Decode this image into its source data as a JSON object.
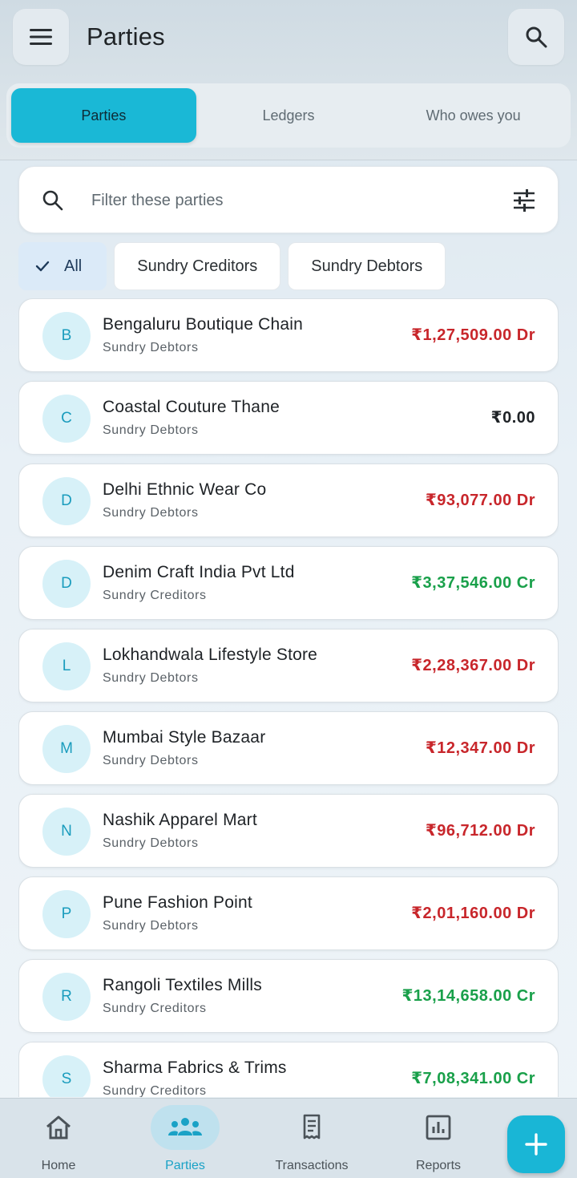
{
  "header": {
    "title": "Parties",
    "menu_icon": "menu-icon",
    "search_icon": "search-icon"
  },
  "tabs": [
    {
      "label": "Parties",
      "active": true
    },
    {
      "label": "Ledgers",
      "active": false
    },
    {
      "label": "Who owes you",
      "active": false
    }
  ],
  "filter": {
    "placeholder": "Filter these parties",
    "value": ""
  },
  "chips": [
    {
      "label": "All",
      "selected": true
    },
    {
      "label": "Sundry Creditors",
      "selected": false
    },
    {
      "label": "Sundry Debtors",
      "selected": false
    }
  ],
  "parties": [
    {
      "initial": "B",
      "name": "Bengaluru Boutique Chain",
      "group": "Sundry Debtors",
      "amount": "₹1,27,509.00 Dr",
      "type": "dr"
    },
    {
      "initial": "C",
      "name": "Coastal Couture Thane",
      "group": "Sundry Debtors",
      "amount": "₹0.00",
      "type": "zero"
    },
    {
      "initial": "D",
      "name": "Delhi Ethnic Wear Co",
      "group": "Sundry Debtors",
      "amount": "₹93,077.00 Dr",
      "type": "dr"
    },
    {
      "initial": "D",
      "name": "Denim Craft India Pvt Ltd",
      "group": "Sundry Creditors",
      "amount": "₹3,37,546.00 Cr",
      "type": "cr"
    },
    {
      "initial": "L",
      "name": "Lokhandwala Lifestyle Store",
      "group": "Sundry Debtors",
      "amount": "₹2,28,367.00 Dr",
      "type": "dr"
    },
    {
      "initial": "M",
      "name": "Mumbai Style Bazaar",
      "group": "Sundry Debtors",
      "amount": "₹12,347.00 Dr",
      "type": "dr"
    },
    {
      "initial": "N",
      "name": "Nashik Apparel Mart",
      "group": "Sundry Debtors",
      "amount": "₹96,712.00 Dr",
      "type": "dr"
    },
    {
      "initial": "P",
      "name": "Pune Fashion Point",
      "group": "Sundry Debtors",
      "amount": "₹2,01,160.00 Dr",
      "type": "dr"
    },
    {
      "initial": "R",
      "name": "Rangoli Textiles Mills",
      "group": "Sundry Creditors",
      "amount": "₹13,14,658.00 Cr",
      "type": "cr"
    },
    {
      "initial": "S",
      "name": "Sharma Fabrics & Trims",
      "group": "Sundry Creditors",
      "amount": "₹7,08,341.00 Cr",
      "type": "cr"
    }
  ],
  "bottom_nav": [
    {
      "label": "Home",
      "icon": "home-icon",
      "active": false
    },
    {
      "label": "Parties",
      "icon": "groups-icon",
      "active": true
    },
    {
      "label": "Transactions",
      "icon": "receipt-icon",
      "active": false
    },
    {
      "label": "Reports",
      "icon": "chart-icon",
      "active": false
    }
  ],
  "fab_icon": "plus-icon",
  "colors": {
    "accent": "#1ab8d6",
    "debit": "#c8262b",
    "credit": "#19a04a"
  }
}
